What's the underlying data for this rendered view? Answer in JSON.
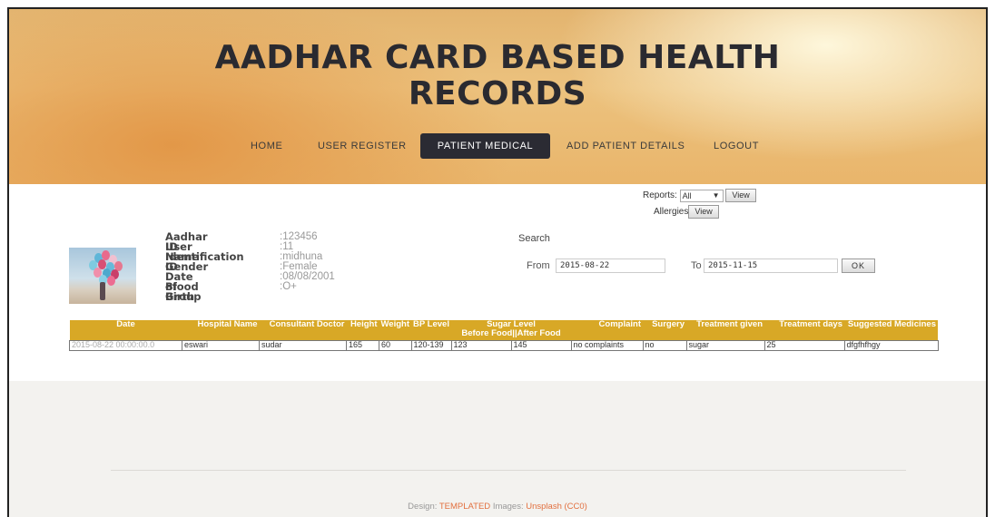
{
  "header": {
    "title_line1": "AADHAR CARD BASED HEALTH",
    "title_line2": "RECORDS"
  },
  "nav": {
    "items": [
      {
        "label": "HOME"
      },
      {
        "label": "USER REGISTER"
      },
      {
        "label": "PATIENT MEDICAL",
        "active": true
      },
      {
        "label": "ADD PATIENT DETAILS"
      },
      {
        "label": "LOGOUT"
      }
    ]
  },
  "reports": {
    "label": "Reports:",
    "selected": "All",
    "view_label": "View",
    "allergies_label": "Allergies",
    "allergies_view_label": "View"
  },
  "profile": {
    "rows": [
      {
        "label": "Aadhar ID",
        "value": ":123456"
      },
      {
        "label": "User Identification ID",
        "value": ":11"
      },
      {
        "label": "Name",
        "value": ":midhuna"
      },
      {
        "label": "Gender",
        "value": ":Female"
      },
      {
        "label": "Date of Birth",
        "value": ":08/08/2001"
      },
      {
        "label": "Blood Group",
        "value": ":O+"
      }
    ]
  },
  "search": {
    "label": "Search",
    "from_label": "From",
    "from_value": "2015-08-22",
    "to_label": "To",
    "to_value": "2015-11-15",
    "ok_label": "OK"
  },
  "table": {
    "headers": [
      "Date",
      "Hospital Name",
      "Consultant Doctor",
      "Height",
      "Weight",
      "BP Level",
      "Sugar Level",
      "Complaint",
      "Surgery",
      "Treatment given",
      "Treatment days",
      "Suggested Medicines"
    ],
    "sugar_subheaders": "Before Food||After Food",
    "rows": [
      [
        "2015-08-22 00:00:00.0",
        "eswari",
        "sudar",
        "165",
        "60",
        "120-139",
        "123",
        "145",
        "no complaints",
        "no",
        "sugar",
        "25",
        "dfgfhfhgy"
      ]
    ]
  },
  "footer": {
    "design_label": "Design:",
    "design_link": "TEMPLATED",
    "images_label": "Images:",
    "images_link": "Unsplash (CC0)"
  },
  "colors": {
    "nav_active": "#2b2b33",
    "table_header": "#d8a826",
    "footer_link": "#e2703f"
  }
}
